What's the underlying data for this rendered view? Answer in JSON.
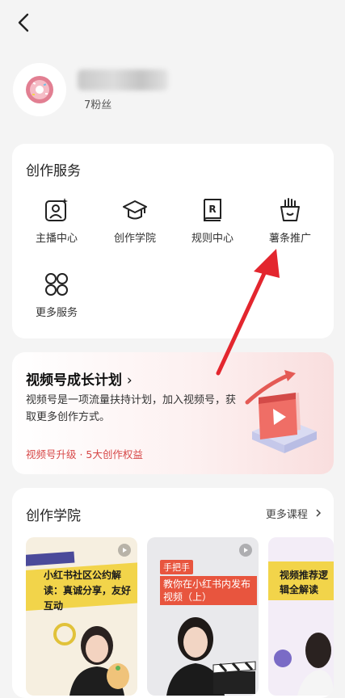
{
  "profile": {
    "fans_label": "7粉丝"
  },
  "services": {
    "title": "创作服务",
    "items": [
      {
        "label": "主播中心",
        "icon": "anchor-center-icon"
      },
      {
        "label": "创作学院",
        "icon": "graduation-cap-icon"
      },
      {
        "label": "规则中心",
        "icon": "rule-book-icon"
      },
      {
        "label": "薯条推广",
        "icon": "fries-icon"
      },
      {
        "label": "更多服务",
        "icon": "grid-icon"
      }
    ]
  },
  "growth": {
    "title": "视频号成长计划",
    "chevron": "›",
    "description": "视频号是一项流量扶持计划，加入视频号，获取更多创作方式。",
    "link": "视频号升级 · 5大创作权益"
  },
  "academy": {
    "title": "创作学院",
    "more_label": "更多课程",
    "courses": [
      {
        "caption": "小红书社区公约解读：真诚分享，友好互动"
      },
      {
        "tag": "手把手",
        "caption": "教你在小红书内发布视频（上）"
      },
      {
        "caption": "视频推荐逻辑全解读"
      }
    ]
  },
  "colors": {
    "accent_red": "#d74848",
    "arrow_red": "#e3262e",
    "card_bg": "#ffffff",
    "page_bg": "#f4f4f4"
  }
}
